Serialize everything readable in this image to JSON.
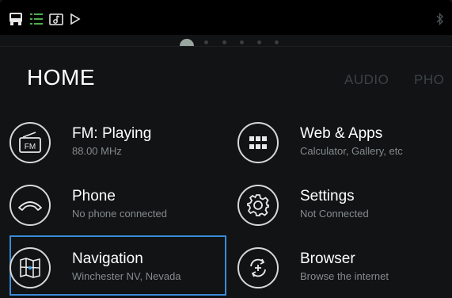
{
  "status_bar": {
    "icons": [
      "bus-icon",
      "list-icon",
      "music-icon",
      "play-icon"
    ],
    "bluetooth_icon": "bluetooth-icon"
  },
  "header": {
    "title": "HOME",
    "tabs": [
      "AUDIO",
      "PHO"
    ]
  },
  "pager": {
    "pages": 6,
    "active": 0
  },
  "tiles": [
    {
      "title": "FM: Playing",
      "subtitle": "88.00 MHz",
      "icon": "radio-icon"
    },
    {
      "title": "Web & Apps",
      "subtitle": "Calculator, Gallery, etc",
      "icon": "apps-grid-icon"
    },
    {
      "title": "Phone",
      "subtitle": "No phone connected",
      "icon": "phone-icon"
    },
    {
      "title": "Settings",
      "subtitle": "Not Connected",
      "icon": "gear-icon"
    },
    {
      "title": "Navigation",
      "subtitle": "Winchester NV, Nevada",
      "icon": "map-icon",
      "focused": true
    },
    {
      "title": "Browser",
      "subtitle": "Browse the internet",
      "icon": "browser-icon"
    }
  ],
  "colors": {
    "accent": "#3a8bd8",
    "active_list": "#4caf50",
    "background": "#111314"
  }
}
